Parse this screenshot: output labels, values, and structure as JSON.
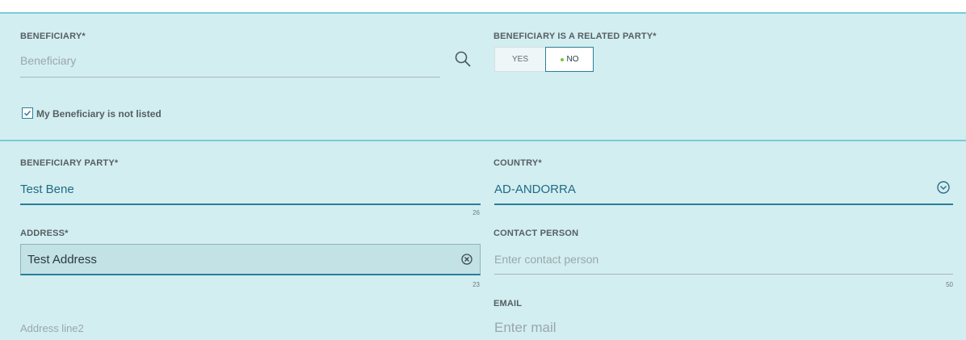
{
  "beneficiary": {
    "label": "BENEFICIARY*",
    "placeholder": "Beneficiary",
    "search_icon": "search-icon"
  },
  "related_party": {
    "label": "BENEFICIARY IS A RELATED PARTY*",
    "options": [
      "YES",
      "NO"
    ],
    "selected": "NO",
    "accent": "#7bc142"
  },
  "not_listed": {
    "label": "My Beneficiary is not listed",
    "checked": true
  },
  "beneficiary_party": {
    "label": "BENEFICIARY PARTY*",
    "value": "Test Bene",
    "counter": "26"
  },
  "country": {
    "label": "COUNTRY*",
    "value": "AD-ANDORRA",
    "icon": "chevron-down-circle-icon"
  },
  "address": {
    "label": "ADDRESS*",
    "value": "Test Address",
    "counter": "23",
    "clear_icon": "clear-circle-icon",
    "line2_placeholder": "Address line2"
  },
  "contact_person": {
    "label": "CONTACT PERSON",
    "placeholder": "Enter contact person",
    "counter": "50"
  },
  "email": {
    "label": "EMAIL",
    "placeholder": "Enter mail"
  },
  "colors": {
    "background": "#d3eef0",
    "accent_line": "#7ccbd6",
    "primary": "#2a7f99"
  }
}
